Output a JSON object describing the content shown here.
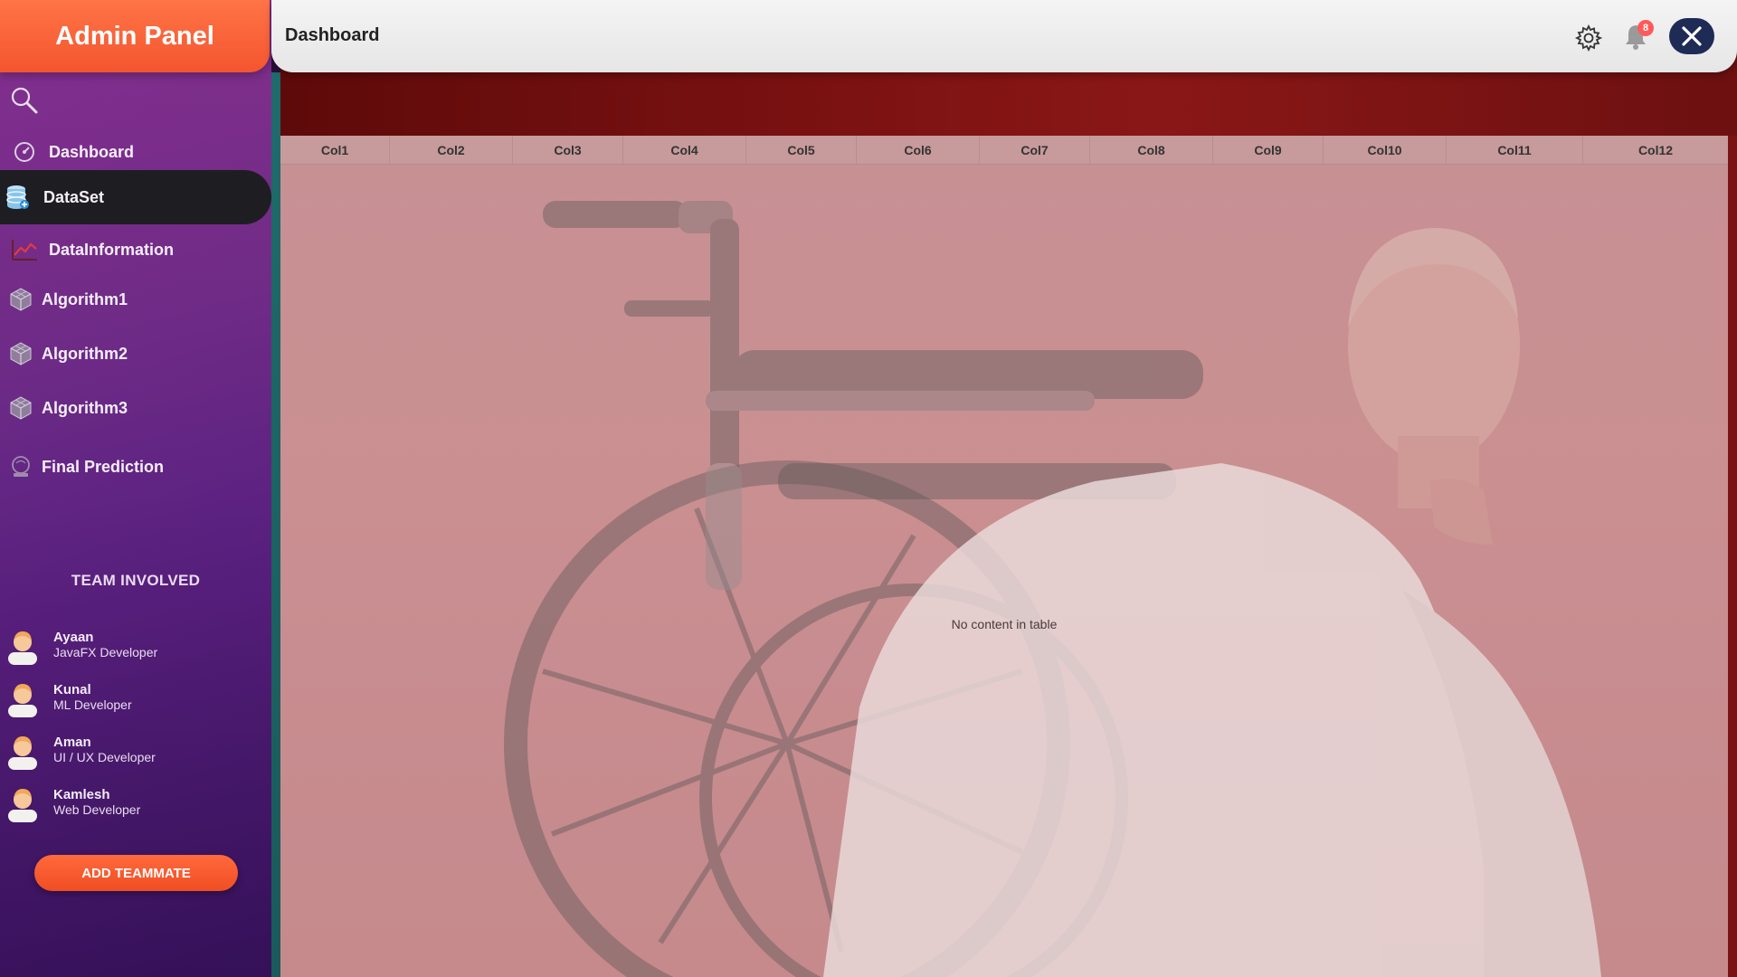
{
  "brand": {
    "title": "Admin Panel"
  },
  "header": {
    "page_title": "Dashboard",
    "notification_count": "8"
  },
  "sidebar": {
    "items": [
      {
        "label": "Dashboard",
        "icon": "gauge-icon",
        "active": false
      },
      {
        "label": "DataSet",
        "icon": "database-icon",
        "active": true
      },
      {
        "label": "DataInformation",
        "icon": "line-chart-icon",
        "active": false
      },
      {
        "label": "Algorithm1",
        "icon": "cube-icon",
        "active": false
      },
      {
        "label": "Algorithm2",
        "icon": "cube-icon",
        "active": false
      },
      {
        "label": "Algorithm3",
        "icon": "cube-icon",
        "active": false
      },
      {
        "label": "Final Prediction",
        "icon": "crystal-ball-icon",
        "active": false
      }
    ]
  },
  "team": {
    "title": "TEAM INVOLVED",
    "members": [
      {
        "name": "Ayaan",
        "role": "JavaFX Developer"
      },
      {
        "name": "Kunal",
        "role": "ML Developer"
      },
      {
        "name": "Aman",
        "role": "UI / UX Developer"
      },
      {
        "name": "Kamlesh",
        "role": "Web Developer"
      }
    ],
    "add_button": "ADD TEAMMATE"
  },
  "table": {
    "columns": [
      "Col1",
      "Col2",
      "Col3",
      "Col4",
      "Col5",
      "Col6",
      "Col7",
      "Col8",
      "Col9",
      "Col10",
      "Col11",
      "Col12"
    ],
    "empty_message": "No content in table"
  },
  "colors": {
    "brand_orange": "#f4552f",
    "sidebar_purple": "#6a2a86",
    "active_item": "#1e1e22",
    "banner_red": "#7d1212",
    "close_button": "#1e2b55",
    "badge_red": "#ff5a5a"
  }
}
